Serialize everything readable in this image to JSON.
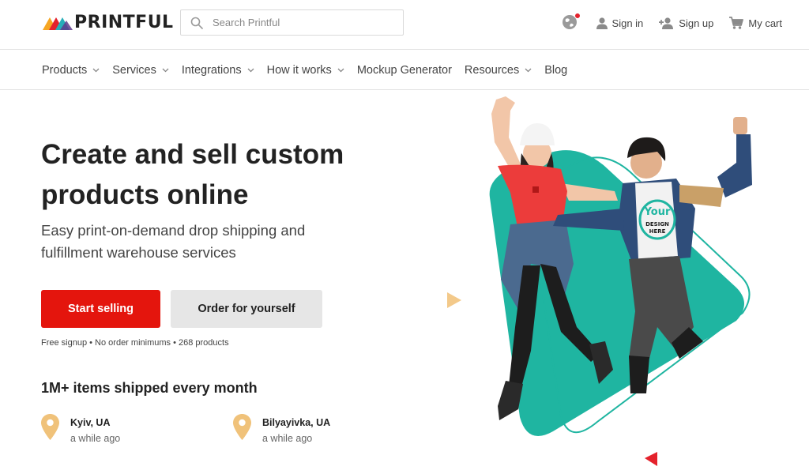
{
  "header": {
    "logo_text": "PRINTFUL",
    "search_placeholder": "Search Printful",
    "sign_in": "Sign in",
    "sign_up": "Sign up",
    "cart": "My cart"
  },
  "nav": {
    "products": "Products",
    "services": "Services",
    "integrations": "Integrations",
    "how_it_works": "How it works",
    "mockup_generator": "Mockup Generator",
    "resources": "Resources",
    "blog": "Blog"
  },
  "hero": {
    "title": "Create and sell custom products online",
    "subtitle": "Easy print-on-demand drop shipping and fulfillment warehouse services",
    "primary_cta": "Start selling",
    "secondary_cta": "Order for yourself",
    "note": "Free signup • No order minimums • 268 products",
    "shipped": "1M+ items shipped every month",
    "locations": [
      {
        "name": "Kyiv, UA",
        "time": "a while ago"
      },
      {
        "name": "Bilyayivka, UA",
        "time": "a while ago"
      }
    ],
    "shirt_print": [
      "Your",
      "DESIGN",
      "HERE"
    ]
  },
  "colors": {
    "brand_red": "#e4150d",
    "teal": "#1fb5a1",
    "pin": "#f0c27a"
  }
}
